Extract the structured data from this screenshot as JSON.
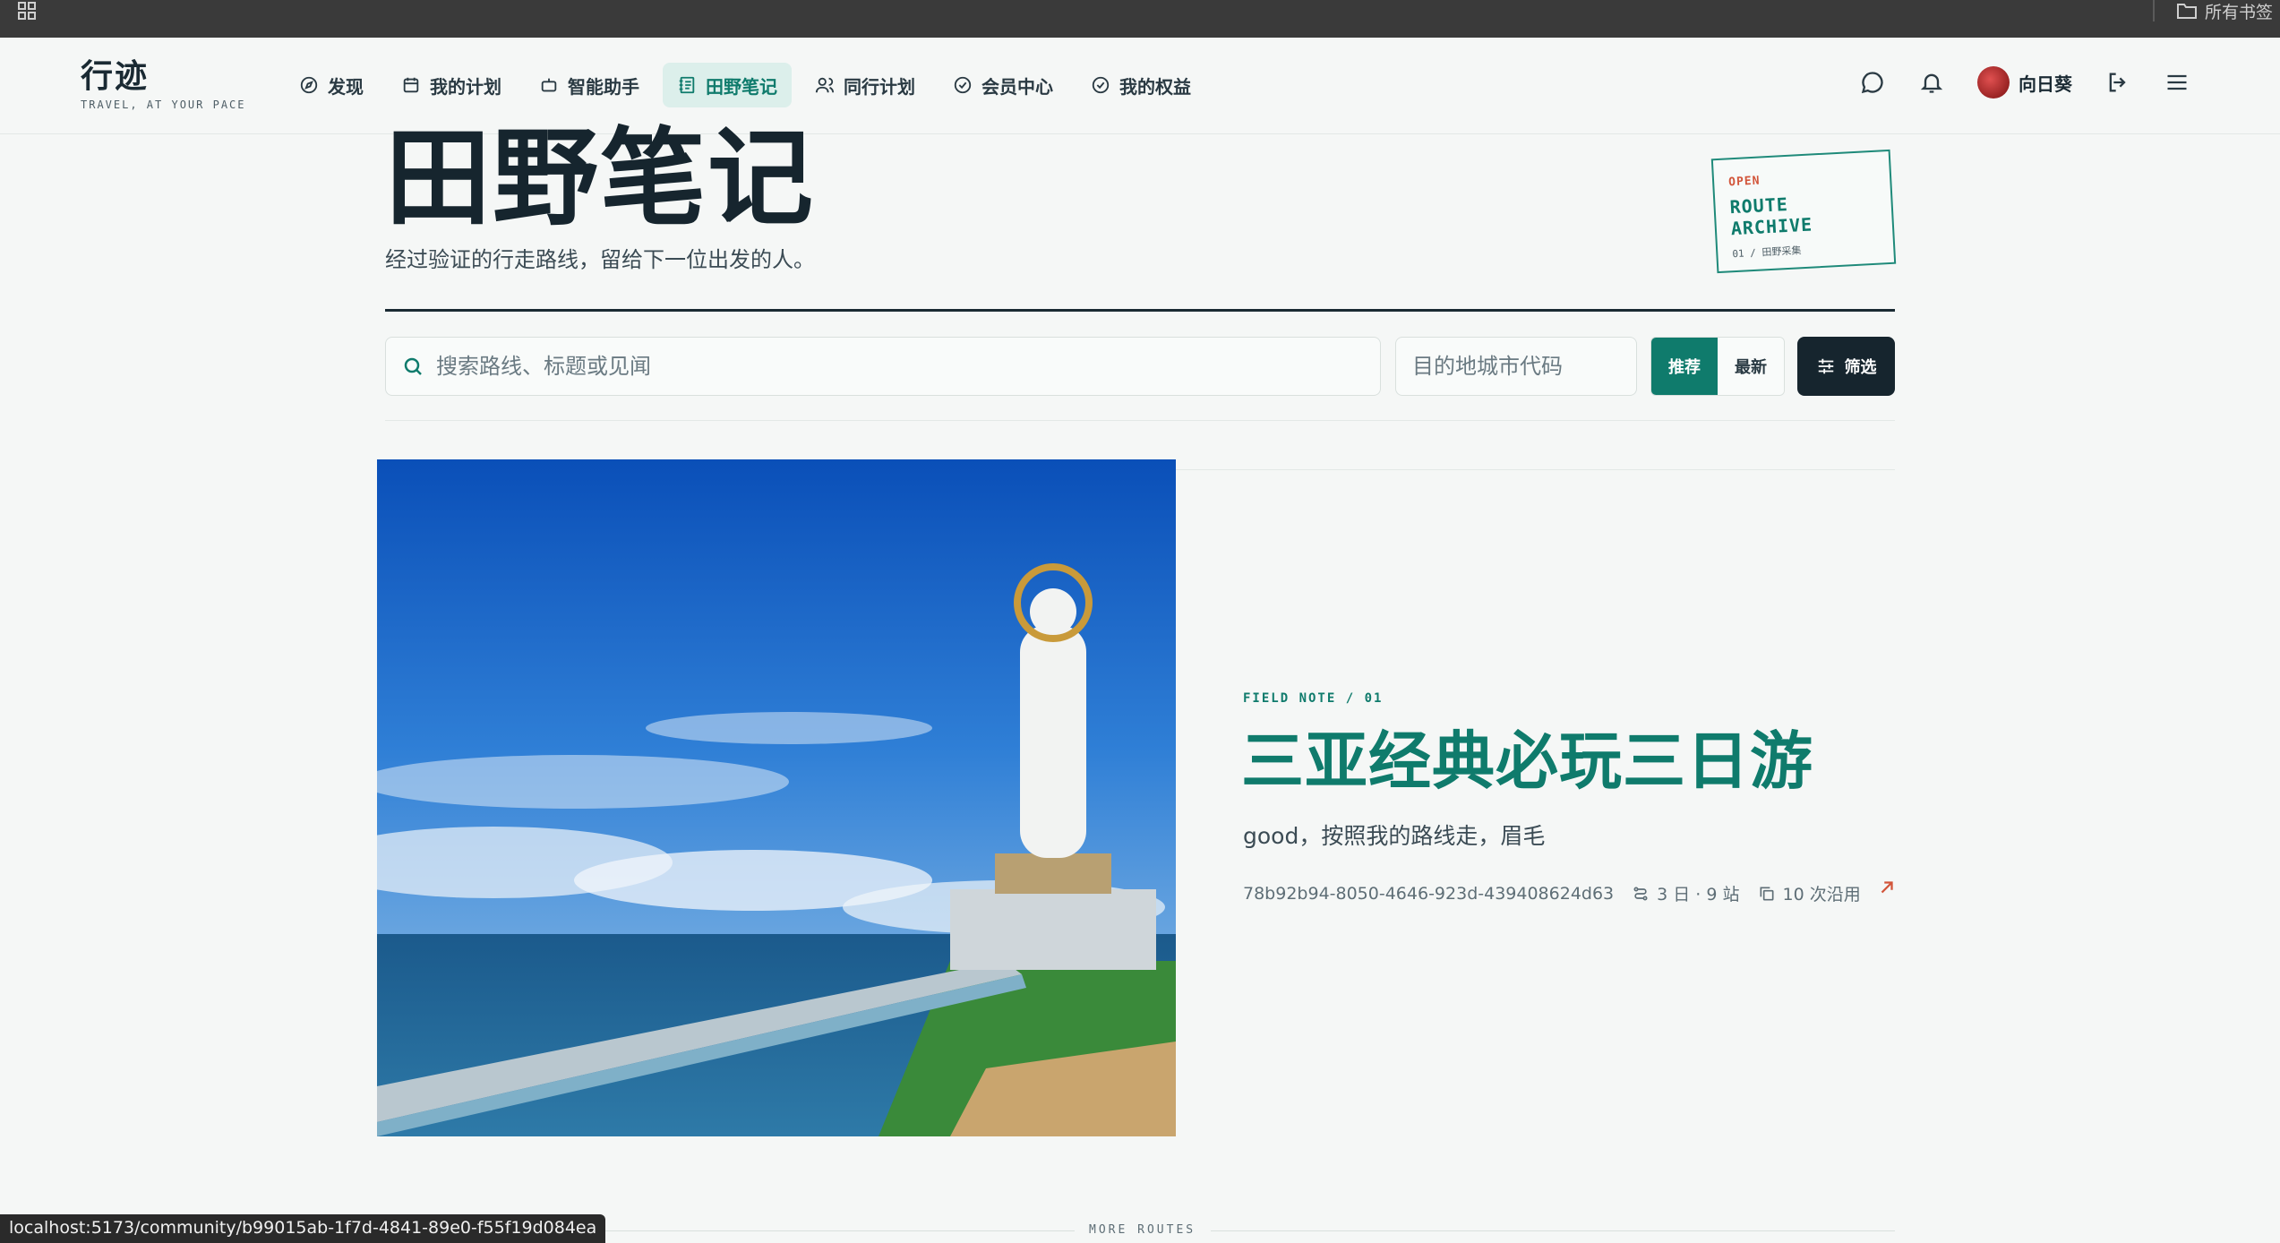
{
  "browser": {
    "bookmarks_folder": "所有书签",
    "status_url": "localhost:5173/community/b99015ab-1f7d-4841-89e0-f55f19d084ea"
  },
  "brand": {
    "title": "行迹",
    "tagline": "TRAVEL, AT YOUR PACE"
  },
  "nav": {
    "items": [
      {
        "label": "发现",
        "icon": "compass-icon",
        "active": false
      },
      {
        "label": "我的计划",
        "icon": "calendar-icon",
        "active": false
      },
      {
        "label": "智能助手",
        "icon": "robot-icon",
        "active": false
      },
      {
        "label": "田野笔记",
        "icon": "notebook-icon",
        "active": true
      },
      {
        "label": "同行计划",
        "icon": "users-icon",
        "active": false
      },
      {
        "label": "会员中心",
        "icon": "check-circle-icon",
        "active": false
      },
      {
        "label": "我的权益",
        "icon": "check-circle-icon",
        "active": false
      }
    ],
    "user_name": "向日葵"
  },
  "hero": {
    "title": "田野笔记",
    "subtitle": "经过验证的行走路线，留给下一位出发的人。",
    "stamp": {
      "open": "OPEN",
      "line1": "ROUTE",
      "line2": "ARCHIVE",
      "meta": "01 / 田野采集"
    }
  },
  "search": {
    "placeholder": "搜索路线、标题或见闻",
    "city_placeholder": "目的地城市代码",
    "sort_recommended": "推荐",
    "sort_latest": "最新",
    "filter_label": "筛选"
  },
  "featured": {
    "kicker": "FIELD NOTE / 01",
    "title": "三亚经典必玩三日游",
    "description": "good，按照我的路线走，眉毛",
    "id": "78b92b94-8050-4646-923d-439408624d63",
    "duration": "3 日 · 9 站",
    "uses": "10 次沿用"
  },
  "more_routes_label": "MORE ROUTES",
  "colors": {
    "accent": "#0f7b6c",
    "dark": "#16252e",
    "stamp_red": "#d2553a",
    "background": "#f5f7f6"
  }
}
